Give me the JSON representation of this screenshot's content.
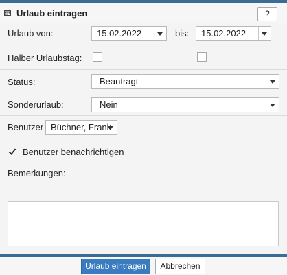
{
  "dialog": {
    "title": "Urlaub eintragen",
    "help_label": "?"
  },
  "form": {
    "from_label": "Urlaub von:",
    "from_value": "15.02.2022",
    "to_label": "bis:",
    "to_value": "15.02.2022",
    "half_day_label": "Halber Urlaubstag:",
    "half_day_from_checked": false,
    "half_day_to_checked": false,
    "status_label": "Status:",
    "status_value": "Beantragt",
    "special_leave_label": "Sonderurlaub:",
    "special_leave_value": "Nein",
    "user_label": "Benutzer",
    "user_value": "Büchner, Frank",
    "notify_label": "Benutzer benachrichtigen",
    "notify_checked": true,
    "remarks_label": "Bemerkungen:",
    "remarks_value": ""
  },
  "footer": {
    "submit_label": "Urlaub eintragen",
    "cancel_label": "Abbrechen"
  },
  "colors": {
    "accent": "#3a6d95",
    "primary_button": "#3b7cc1"
  }
}
